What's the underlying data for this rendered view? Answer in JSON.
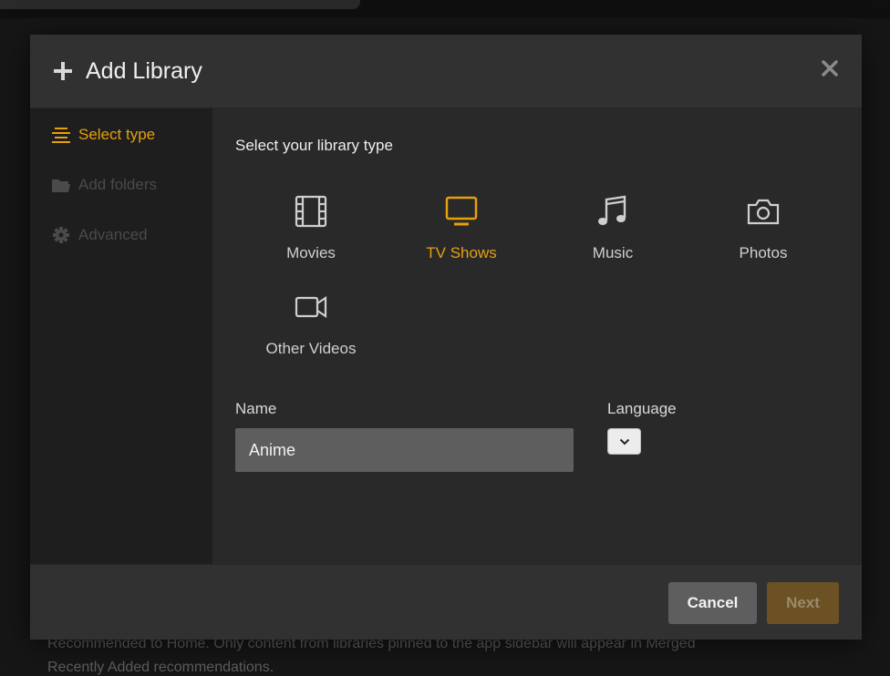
{
  "background": {
    "line1": "Recommended to Home. Only content from libraries pinned to the app sidebar will appear in Merged",
    "line2": "Recently Added recommendations."
  },
  "modal": {
    "title": "Add Library",
    "header_icon": "plus-icon",
    "close_icon": "close-icon"
  },
  "sidebar": {
    "items": [
      {
        "label": "Select type",
        "icon": "list-icon",
        "state": "active"
      },
      {
        "label": "Add folders",
        "icon": "folder-icon",
        "state": "disabled"
      },
      {
        "label": "Advanced",
        "icon": "gear-icon",
        "state": "disabled"
      }
    ]
  },
  "content": {
    "heading": "Select your library type",
    "types": [
      {
        "label": "Movies",
        "icon": "film-icon",
        "selected": false
      },
      {
        "label": "TV Shows",
        "icon": "tv-icon",
        "selected": true
      },
      {
        "label": "Music",
        "icon": "music-note-icon",
        "selected": false
      },
      {
        "label": "Photos",
        "icon": "camera-icon",
        "selected": false
      },
      {
        "label": "Other Videos",
        "icon": "video-camera-icon",
        "selected": false
      }
    ],
    "name_label": "Name",
    "name_value": "Anime",
    "language_label": "Language",
    "language_value": ""
  },
  "footer": {
    "cancel_label": "Cancel",
    "next_label": "Next"
  },
  "colors": {
    "accent": "#e5a00d",
    "modal_bg": "#292929",
    "sidebar_bg": "#1e1e1e",
    "next_button_bg": "#6b5124",
    "cancel_button_bg": "#5e5e5e"
  }
}
